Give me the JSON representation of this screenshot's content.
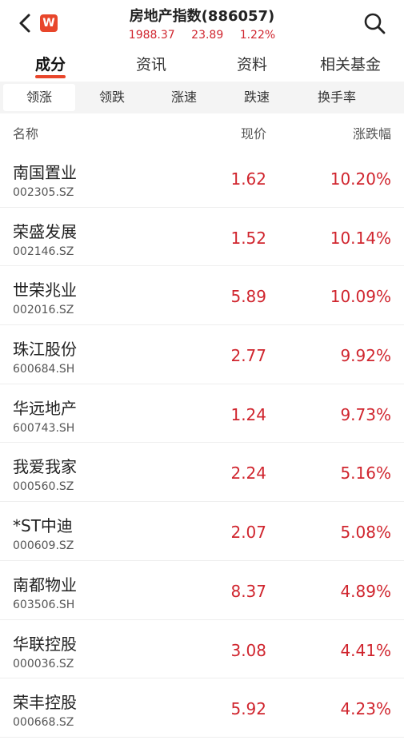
{
  "header": {
    "title": "房地产指数(886057)",
    "logo_text": "W",
    "index_value": "1988.37",
    "change": "23.89",
    "change_pct": "1.22%"
  },
  "main_tabs": [
    {
      "label": "成分",
      "active": true
    },
    {
      "label": "资讯",
      "active": false
    },
    {
      "label": "资料",
      "active": false
    },
    {
      "label": "相关基金",
      "active": false
    }
  ],
  "sub_tabs": [
    {
      "label": "领涨",
      "active": true
    },
    {
      "label": "领跌",
      "active": false
    },
    {
      "label": "涨速",
      "active": false
    },
    {
      "label": "跌速",
      "active": false
    },
    {
      "label": "换手率",
      "active": false
    }
  ],
  "columns": {
    "name": "名称",
    "price": "现价",
    "change": "涨跌幅"
  },
  "rows": [
    {
      "name": "南国置业",
      "code": "002305.SZ",
      "price": "1.62",
      "change": "10.20%"
    },
    {
      "name": "荣盛发展",
      "code": "002146.SZ",
      "price": "1.52",
      "change": "10.14%"
    },
    {
      "name": "世荣兆业",
      "code": "002016.SZ",
      "price": "5.89",
      "change": "10.09%"
    },
    {
      "name": "珠江股份",
      "code": "600684.SH",
      "price": "2.77",
      "change": "9.92%"
    },
    {
      "name": "华远地产",
      "code": "600743.SH",
      "price": "1.24",
      "change": "9.73%"
    },
    {
      "name": "我爱我家",
      "code": "000560.SZ",
      "price": "2.24",
      "change": "5.16%"
    },
    {
      "name": "*ST中迪",
      "code": "000609.SZ",
      "price": "2.07",
      "change": "5.08%"
    },
    {
      "name": "南都物业",
      "code": "603506.SH",
      "price": "8.37",
      "change": "4.89%"
    },
    {
      "name": "华联控股",
      "code": "000036.SZ",
      "price": "3.08",
      "change": "4.41%"
    },
    {
      "name": "荣丰控股",
      "code": "000668.SZ",
      "price": "5.92",
      "change": "4.23%"
    }
  ],
  "colors": {
    "accent": "#e8462b",
    "rise": "#d0252e"
  },
  "icons": {
    "back": "back-arrow-icon",
    "search": "search-icon"
  }
}
